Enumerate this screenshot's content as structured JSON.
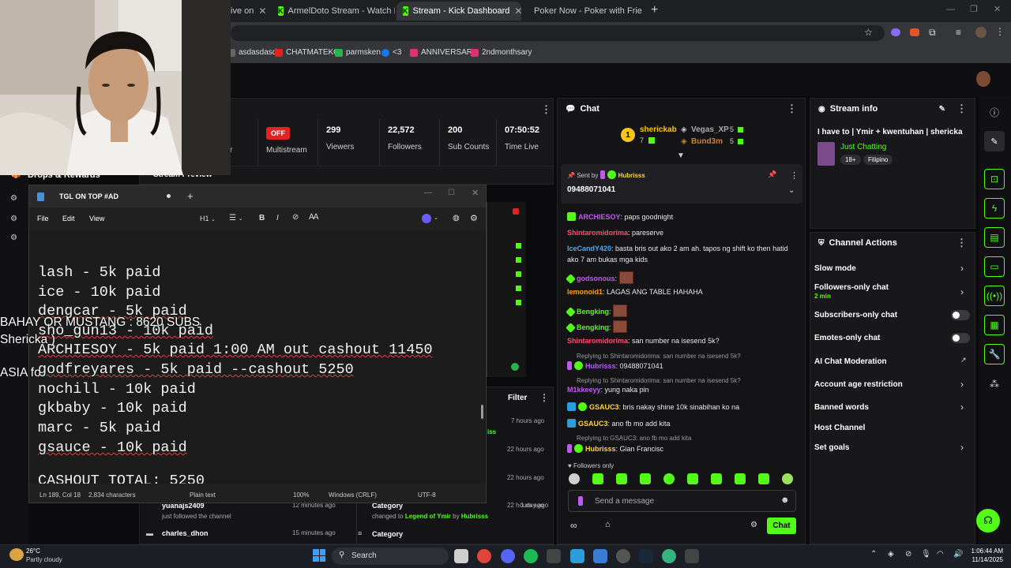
{
  "browser": {
    "tabs": [
      {
        "label": "ive on"
      },
      {
        "label": "ArmelDoto Stream - Watch Live"
      },
      {
        "label": "Stream - Kick Dashboard"
      },
      {
        "label": "Poker Now - Poker with Frie"
      }
    ],
    "new_tab": "+",
    "bookmarks": [
      "asdasdasd",
      "CHATMATEKO",
      "parmsken",
      "<3",
      "ANNIVERSARY",
      "2ndmonthsary"
    ]
  },
  "dashboard": {
    "stream_panel": {
      "multistream_badge": "OFF",
      "multistream_label": "Multistream",
      "viewers": "299",
      "viewers_label": "Viewers",
      "followers": "22,572",
      "followers_label": "Followers",
      "subs": "200",
      "subs_label": "Sub Counts",
      "time_live": "07:50:52",
      "time_live_label": "Time Live",
      "left_fragment": "r"
    },
    "drops_label": "Drops & Rewards",
    "stream_preview_label": "Stream Preview",
    "filter_label": "Filter",
    "activity": [
      {
        "time": "7 hours ago"
      },
      {
        "time": "22 hours ago"
      },
      {
        "time": "22 hours ago"
      },
      {
        "user": "yuanajs2409",
        "desc": "just followed the channel",
        "time": "12 minutes ago"
      },
      {
        "user": "charles_dhon",
        "time": "15 minutes ago"
      }
    ],
    "activity_right": [
      {
        "title": "Category",
        "desc_prefix": "changed to",
        "link": "Legend of Ymir",
        "by_prefix": "by",
        "by": "Hubrisss",
        "time": "22 hours ago"
      },
      {
        "title": "Category",
        "time": "1 day ago"
      }
    ],
    "activity_fragment": "iss"
  },
  "chat": {
    "title": "Chat",
    "leaderboard": [
      {
        "rank": "1",
        "name": "sherickab",
        "count": "7"
      },
      {
        "name": "Vegas_XP",
        "count": "5"
      },
      {
        "name": "Bund3m",
        "count": "5"
      }
    ],
    "pinned": {
      "sent_by_label": "Sent by",
      "user": "Hubrisss",
      "message": "09488071041"
    },
    "messages": [
      {
        "user": "ARCHIESOY",
        "user_color": "#bf5af2",
        "text": ": paps goodnight"
      },
      {
        "user": "Shintaromidorima",
        "user_color": "#ff4d6d",
        "text": ": pareserve"
      },
      {
        "user": "IceCandY420",
        "user_color": "#4aa8ff",
        "text": ": basta bris out ako 2 am ah. tapos ng shift ko then hatid",
        "text2": "ako 7 am bukas mga kids"
      },
      {
        "user": "godsonous",
        "user_color": "#bf5af2",
        "text": ":"
      },
      {
        "user": "lemonoid1",
        "user_color": "#ff9f1a",
        "text": ": LAGAS ANG TABLE HAHAHA"
      },
      {
        "user": "Bengking",
        "user_color": "#53fc18",
        "text": ":"
      },
      {
        "user": "Bengking",
        "user_color": "#53fc18",
        "text": ":"
      },
      {
        "user": "Shintaromidorima",
        "user_color": "#ff4d6d",
        "text": ": san number na isesend 5k?"
      },
      {
        "reply": "Replying to Shintaromidorima: san number na isesend 5k?"
      },
      {
        "user": "Hubrisss",
        "user_color": "#bf5af2",
        "text": ": 09488071041"
      },
      {
        "reply": "Replying to Shintaromidorima: san number na isesend 5k?"
      },
      {
        "user": "M1kkeeyy",
        "user_color": "#bf5af2",
        "text": ": yung naka pin"
      },
      {
        "user": "GSAUC3",
        "user_color": "#ffd43b",
        "text": ": bris nakay shine 10k sinabihan ko na"
      },
      {
        "user": "GSAUC3",
        "user_color": "#ffd43b",
        "text": ": ano fb mo add kita"
      },
      {
        "reply": "Replying to GSAUC3: ano fb mo add kita"
      },
      {
        "user": "Hubrisss",
        "user_color": "#ffd43b",
        "text": ": Gian Francisc"
      }
    ],
    "followers_only_label": "Followers only",
    "input_placeholder": "Send a message",
    "chat_button": "Chat"
  },
  "stream_info": {
    "title": "Stream info",
    "stream_title": "I have to | Ymir + kwentuhan | shericka",
    "category": "Just Chatting",
    "tags": [
      "18+",
      "Filipino"
    ]
  },
  "channel_actions": {
    "title": "Channel Actions",
    "items": [
      {
        "label": "Slow mode"
      },
      {
        "label": "Followers-only chat",
        "sub": "2 min"
      },
      {
        "label": "Subscribers-only chat"
      },
      {
        "label": "Emotes-only chat"
      },
      {
        "label": "AI Chat Moderation"
      },
      {
        "label": "Account age restriction"
      },
      {
        "label": "Banned words"
      },
      {
        "label": "Host Channel"
      },
      {
        "label": "Set goals"
      }
    ]
  },
  "notepad": {
    "title": "TGL ON TOP #AD",
    "menu": [
      "File",
      "Edit",
      "View"
    ],
    "heading_select": "H1",
    "lines": [
      "lash - 5k paid",
      "ice - 10k paid",
      "dengcar - 5k paid",
      "sho_gun13 - 10k paid",
      "ARCHIESOY - 5k paid 1:00 AM out cashout 11450",
      "godfreyares - 5k paid --cashout 5250",
      "nochill - 10k paid",
      "gkbaby - 10k paid",
      "marc - 5k paid",
      "gsauce - 10k paid",
      "",
      "CASHOUT TOTAL: 5250"
    ],
    "status": {
      "position": "Ln 189, Col 18",
      "chars": "2,834 characters",
      "format": "Plain text",
      "zoom": "100%",
      "line_endings": "Windows (CRLF)",
      "encoding": "UTF-8"
    }
  },
  "overlay": {
    "line1": "BAHAY OR MUSTANG : 8620 SUBS",
    "line2": "Shericka )",
    "line3": "ASIA fo"
  },
  "taskbar": {
    "weather_temp": "26°C",
    "weather_desc": "Partly cloudy",
    "search_label": "Search",
    "time": "1:06:44 AM",
    "date": "11/14/2025"
  }
}
